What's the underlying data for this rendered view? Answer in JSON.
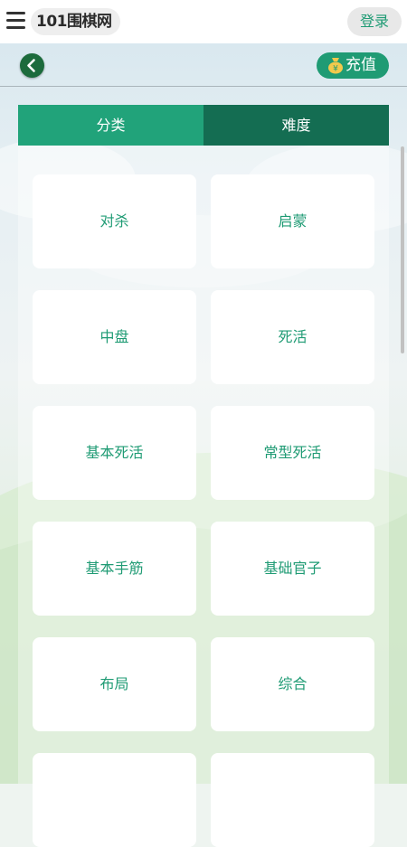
{
  "topbar": {
    "logo_text": "101围棋网",
    "login_label": "登录"
  },
  "subbar": {
    "recharge_label": "充值"
  },
  "tabs": [
    {
      "label": "分类"
    },
    {
      "label": "难度"
    }
  ],
  "categories": [
    {
      "label": "对杀"
    },
    {
      "label": "启蒙"
    },
    {
      "label": "中盘"
    },
    {
      "label": "死活"
    },
    {
      "label": "基本死活"
    },
    {
      "label": "常型死活"
    },
    {
      "label": "基本手筋"
    },
    {
      "label": "基础官子"
    },
    {
      "label": "布局"
    },
    {
      "label": "综合"
    },
    {
      "label": ""
    },
    {
      "label": ""
    }
  ],
  "colors": {
    "accent": "#1f9b74",
    "tab_dark": "#146d52",
    "back": "#1c6b3c"
  }
}
